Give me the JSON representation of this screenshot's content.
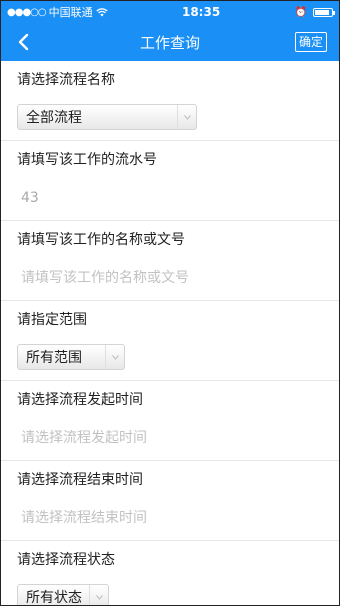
{
  "status_bar": {
    "signal": "●●●○○",
    "carrier": "中国联通",
    "time": "18:35"
  },
  "nav": {
    "back_icon": "chevron-left-icon",
    "title": "工作查询",
    "confirm_label": "确定"
  },
  "form": {
    "process_name": {
      "label": "请选择流程名称",
      "selected": "全部流程"
    },
    "serial_number": {
      "label": "请填写该工作的流水号",
      "value": "43"
    },
    "work_name": {
      "label": "请填写该工作的名称或文号",
      "placeholder": "请填写该工作的名称或文号"
    },
    "scope": {
      "label": "请指定范围",
      "selected": "所有范围"
    },
    "start_time": {
      "label": "请选择流程发起时间",
      "placeholder": "请选择流程发起时间"
    },
    "end_time": {
      "label": "请选择流程结束时间",
      "placeholder": "请选择流程结束时间"
    },
    "status": {
      "label": "请选择流程状态",
      "selected": "所有状态"
    }
  },
  "colors": {
    "header_blue": "#1a8ff5"
  }
}
